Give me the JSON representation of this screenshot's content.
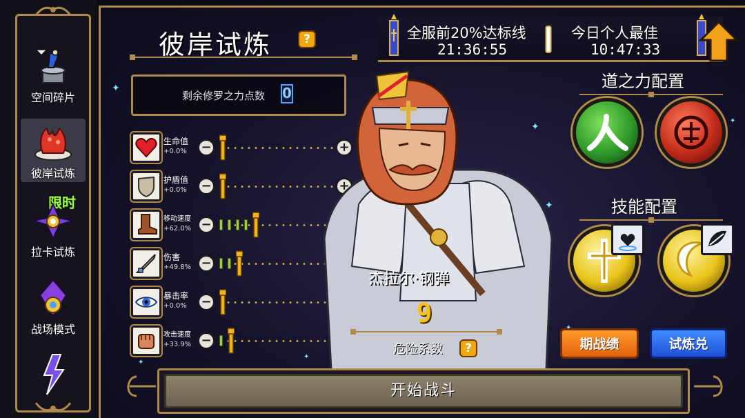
{
  "sidebar": {
    "tabs": [
      {
        "label": "空间碎片",
        "icon": "space-fragment-icon",
        "active": false
      },
      {
        "label": "彼岸试炼",
        "icon": "coral-trial-icon",
        "active": true
      },
      {
        "label": "拉卡试炼",
        "icon": "laka-trial-icon",
        "active": false
      },
      {
        "label": "战场模式",
        "icon": "battlefield-mode-icon",
        "active": false
      },
      {
        "label": "",
        "icon": "lightning-mode-icon",
        "active": false
      }
    ],
    "limited_badge": "限时"
  },
  "page": {
    "title": "彼岸试炼",
    "help": "?"
  },
  "timer": {
    "server_label": "全服前20%达标线",
    "server_time": "21:36:55",
    "personal_label": "今日个人最佳",
    "personal_time": "10:47:33"
  },
  "points": {
    "label": "剩余修罗之力点数",
    "value": "0"
  },
  "stats": [
    {
      "name": "生命值",
      "pct": "+0.0%",
      "icon": "heart-icon",
      "level": 0
    },
    {
      "name": "护盾值",
      "pct": "+0.0%",
      "icon": "shield-icon",
      "level": 0
    },
    {
      "name": "移动速度",
      "pct": "+62.0%",
      "icon": "boot-icon",
      "level": 4
    },
    {
      "name": "伤害",
      "pct": "+49.8%",
      "icon": "sword-icon",
      "level": 2
    },
    {
      "name": "暴击率",
      "pct": "+0.0%",
      "icon": "eye-icon",
      "level": 0
    },
    {
      "name": "攻击速度",
      "pct": "+33.9%",
      "icon": "fist-icon",
      "level": 1
    }
  ],
  "character": {
    "name": "杰拉尔·钢弹",
    "danger_value": "9",
    "danger_label": "危险系数"
  },
  "config": {
    "power_title": "道之力配置",
    "skill_title": "技能配置",
    "power_orbs": [
      {
        "icon": "human-glyph-icon",
        "color": "#2f9a2a"
      },
      {
        "icon": "demon-seal-icon",
        "color": "#c22b1a"
      }
    ],
    "skill_orbs": [
      {
        "icon": "holy-cross-icon",
        "color": "#e8c41a"
      },
      {
        "icon": "crescent-moon-icon",
        "color": "#e8c41a"
      }
    ]
  },
  "buttons": {
    "record": "期战绩",
    "exchange": "试炼兑",
    "start": "开始战斗"
  }
}
